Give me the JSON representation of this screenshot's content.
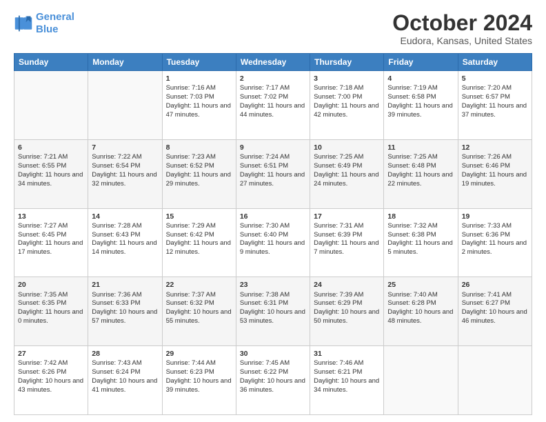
{
  "header": {
    "logo_line1": "General",
    "logo_line2": "Blue",
    "title": "October 2024",
    "subtitle": "Eudora, Kansas, United States"
  },
  "columns": [
    "Sunday",
    "Monday",
    "Tuesday",
    "Wednesday",
    "Thursday",
    "Friday",
    "Saturday"
  ],
  "weeks": [
    [
      {
        "day": "",
        "sunrise": "",
        "sunset": "",
        "daylight": ""
      },
      {
        "day": "",
        "sunrise": "",
        "sunset": "",
        "daylight": ""
      },
      {
        "day": "1",
        "sunrise": "Sunrise: 7:16 AM",
        "sunset": "Sunset: 7:03 PM",
        "daylight": "Daylight: 11 hours and 47 minutes."
      },
      {
        "day": "2",
        "sunrise": "Sunrise: 7:17 AM",
        "sunset": "Sunset: 7:02 PM",
        "daylight": "Daylight: 11 hours and 44 minutes."
      },
      {
        "day": "3",
        "sunrise": "Sunrise: 7:18 AM",
        "sunset": "Sunset: 7:00 PM",
        "daylight": "Daylight: 11 hours and 42 minutes."
      },
      {
        "day": "4",
        "sunrise": "Sunrise: 7:19 AM",
        "sunset": "Sunset: 6:58 PM",
        "daylight": "Daylight: 11 hours and 39 minutes."
      },
      {
        "day": "5",
        "sunrise": "Sunrise: 7:20 AM",
        "sunset": "Sunset: 6:57 PM",
        "daylight": "Daylight: 11 hours and 37 minutes."
      }
    ],
    [
      {
        "day": "6",
        "sunrise": "Sunrise: 7:21 AM",
        "sunset": "Sunset: 6:55 PM",
        "daylight": "Daylight: 11 hours and 34 minutes."
      },
      {
        "day": "7",
        "sunrise": "Sunrise: 7:22 AM",
        "sunset": "Sunset: 6:54 PM",
        "daylight": "Daylight: 11 hours and 32 minutes."
      },
      {
        "day": "8",
        "sunrise": "Sunrise: 7:23 AM",
        "sunset": "Sunset: 6:52 PM",
        "daylight": "Daylight: 11 hours and 29 minutes."
      },
      {
        "day": "9",
        "sunrise": "Sunrise: 7:24 AM",
        "sunset": "Sunset: 6:51 PM",
        "daylight": "Daylight: 11 hours and 27 minutes."
      },
      {
        "day": "10",
        "sunrise": "Sunrise: 7:25 AM",
        "sunset": "Sunset: 6:49 PM",
        "daylight": "Daylight: 11 hours and 24 minutes."
      },
      {
        "day": "11",
        "sunrise": "Sunrise: 7:25 AM",
        "sunset": "Sunset: 6:48 PM",
        "daylight": "Daylight: 11 hours and 22 minutes."
      },
      {
        "day": "12",
        "sunrise": "Sunrise: 7:26 AM",
        "sunset": "Sunset: 6:46 PM",
        "daylight": "Daylight: 11 hours and 19 minutes."
      }
    ],
    [
      {
        "day": "13",
        "sunrise": "Sunrise: 7:27 AM",
        "sunset": "Sunset: 6:45 PM",
        "daylight": "Daylight: 11 hours and 17 minutes."
      },
      {
        "day": "14",
        "sunrise": "Sunrise: 7:28 AM",
        "sunset": "Sunset: 6:43 PM",
        "daylight": "Daylight: 11 hours and 14 minutes."
      },
      {
        "day": "15",
        "sunrise": "Sunrise: 7:29 AM",
        "sunset": "Sunset: 6:42 PM",
        "daylight": "Daylight: 11 hours and 12 minutes."
      },
      {
        "day": "16",
        "sunrise": "Sunrise: 7:30 AM",
        "sunset": "Sunset: 6:40 PM",
        "daylight": "Daylight: 11 hours and 9 minutes."
      },
      {
        "day": "17",
        "sunrise": "Sunrise: 7:31 AM",
        "sunset": "Sunset: 6:39 PM",
        "daylight": "Daylight: 11 hours and 7 minutes."
      },
      {
        "day": "18",
        "sunrise": "Sunrise: 7:32 AM",
        "sunset": "Sunset: 6:38 PM",
        "daylight": "Daylight: 11 hours and 5 minutes."
      },
      {
        "day": "19",
        "sunrise": "Sunrise: 7:33 AM",
        "sunset": "Sunset: 6:36 PM",
        "daylight": "Daylight: 11 hours and 2 minutes."
      }
    ],
    [
      {
        "day": "20",
        "sunrise": "Sunrise: 7:35 AM",
        "sunset": "Sunset: 6:35 PM",
        "daylight": "Daylight: 11 hours and 0 minutes."
      },
      {
        "day": "21",
        "sunrise": "Sunrise: 7:36 AM",
        "sunset": "Sunset: 6:33 PM",
        "daylight": "Daylight: 10 hours and 57 minutes."
      },
      {
        "day": "22",
        "sunrise": "Sunrise: 7:37 AM",
        "sunset": "Sunset: 6:32 PM",
        "daylight": "Daylight: 10 hours and 55 minutes."
      },
      {
        "day": "23",
        "sunrise": "Sunrise: 7:38 AM",
        "sunset": "Sunset: 6:31 PM",
        "daylight": "Daylight: 10 hours and 53 minutes."
      },
      {
        "day": "24",
        "sunrise": "Sunrise: 7:39 AM",
        "sunset": "Sunset: 6:29 PM",
        "daylight": "Daylight: 10 hours and 50 minutes."
      },
      {
        "day": "25",
        "sunrise": "Sunrise: 7:40 AM",
        "sunset": "Sunset: 6:28 PM",
        "daylight": "Daylight: 10 hours and 48 minutes."
      },
      {
        "day": "26",
        "sunrise": "Sunrise: 7:41 AM",
        "sunset": "Sunset: 6:27 PM",
        "daylight": "Daylight: 10 hours and 46 minutes."
      }
    ],
    [
      {
        "day": "27",
        "sunrise": "Sunrise: 7:42 AM",
        "sunset": "Sunset: 6:26 PM",
        "daylight": "Daylight: 10 hours and 43 minutes."
      },
      {
        "day": "28",
        "sunrise": "Sunrise: 7:43 AM",
        "sunset": "Sunset: 6:24 PM",
        "daylight": "Daylight: 10 hours and 41 minutes."
      },
      {
        "day": "29",
        "sunrise": "Sunrise: 7:44 AM",
        "sunset": "Sunset: 6:23 PM",
        "daylight": "Daylight: 10 hours and 39 minutes."
      },
      {
        "day": "30",
        "sunrise": "Sunrise: 7:45 AM",
        "sunset": "Sunset: 6:22 PM",
        "daylight": "Daylight: 10 hours and 36 minutes."
      },
      {
        "day": "31",
        "sunrise": "Sunrise: 7:46 AM",
        "sunset": "Sunset: 6:21 PM",
        "daylight": "Daylight: 10 hours and 34 minutes."
      },
      {
        "day": "",
        "sunrise": "",
        "sunset": "",
        "daylight": ""
      },
      {
        "day": "",
        "sunrise": "",
        "sunset": "",
        "daylight": ""
      }
    ]
  ]
}
